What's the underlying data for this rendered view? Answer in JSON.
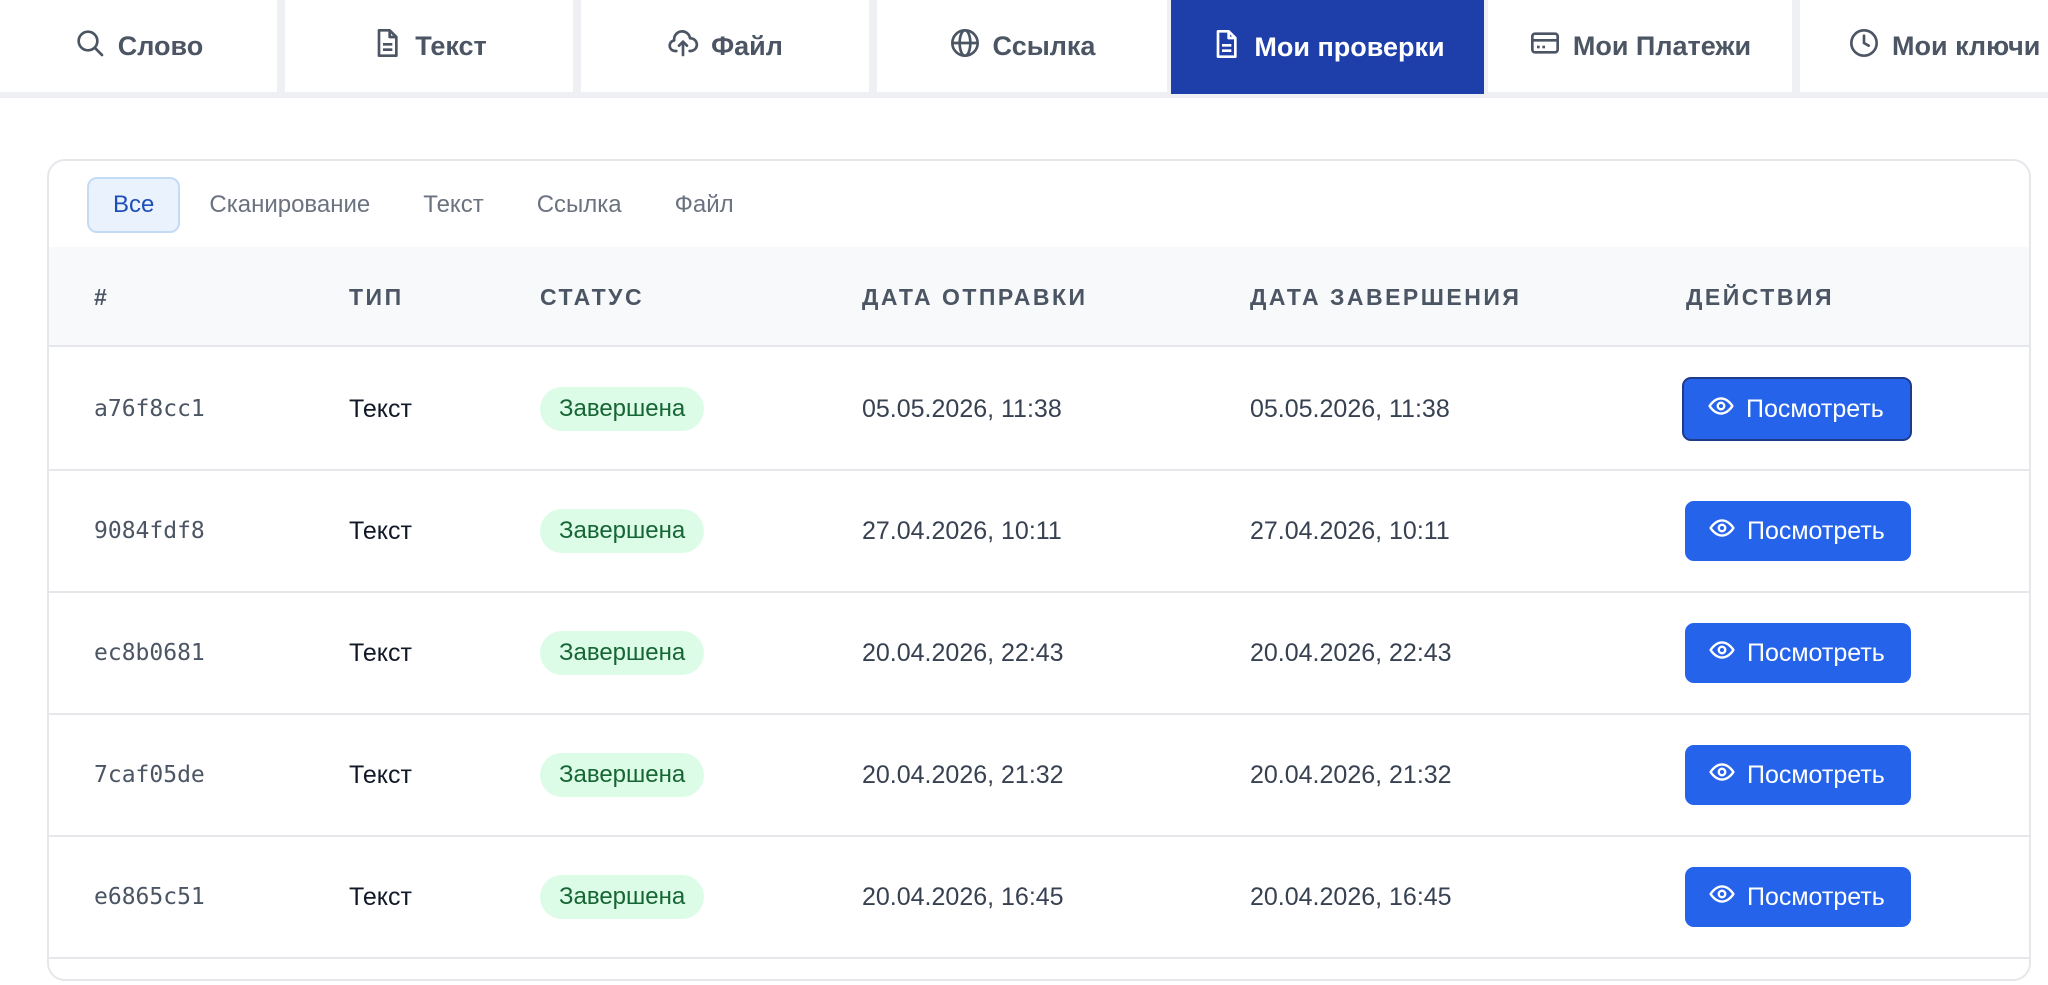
{
  "tabs": [
    {
      "label": "Слово",
      "icon": "search-icon",
      "active": false
    },
    {
      "label": "Текст",
      "icon": "document-icon",
      "active": false
    },
    {
      "label": "Файл",
      "icon": "cloud-upload-icon",
      "active": false
    },
    {
      "label": "Ссылка",
      "icon": "globe-icon",
      "active": false
    },
    {
      "label": "Мои проверки",
      "icon": "document-icon",
      "active": true
    },
    {
      "label": "Мои Платежи",
      "icon": "credit-card-icon",
      "active": false
    },
    {
      "label": "Мои ключи",
      "icon": "clock-icon",
      "active": false
    }
  ],
  "filters": [
    {
      "label": "Все",
      "active": true
    },
    {
      "label": "Сканирование",
      "active": false
    },
    {
      "label": "Текст",
      "active": false
    },
    {
      "label": "Ссылка",
      "active": false
    },
    {
      "label": "Файл",
      "active": false
    }
  ],
  "table": {
    "headers": [
      "#",
      "ТИП",
      "СТАТУС",
      "ДАТА ОТПРАВКИ",
      "ДАТА ЗАВЕРШЕНИЯ",
      "ДЕЙСТВИЯ"
    ],
    "view_label": "Посмотреть",
    "rows": [
      {
        "id": "a76f8cc1",
        "type": "Текст",
        "status": "Завершена",
        "sent": "05.05.2026, 11:38",
        "done": "05.05.2026, 11:38"
      },
      {
        "id": "9084fdf8",
        "type": "Текст",
        "status": "Завершена",
        "sent": "27.04.2026, 10:11",
        "done": "27.04.2026, 10:11"
      },
      {
        "id": "ec8b0681",
        "type": "Текст",
        "status": "Завершена",
        "sent": "20.04.2026, 22:43",
        "done": "20.04.2026, 22:43"
      },
      {
        "id": "7caf05de",
        "type": "Текст",
        "status": "Завершена",
        "sent": "20.04.2026, 21:32",
        "done": "20.04.2026, 21:32"
      },
      {
        "id": "e6865c51",
        "type": "Текст",
        "status": "Завершена",
        "sent": "20.04.2026, 16:45",
        "done": "20.04.2026, 16:45"
      }
    ]
  },
  "colors": {
    "active_tab": "#1e3faa",
    "primary_button": "#2563eb",
    "status_bg": "#dcfce7",
    "status_text": "#166534"
  }
}
